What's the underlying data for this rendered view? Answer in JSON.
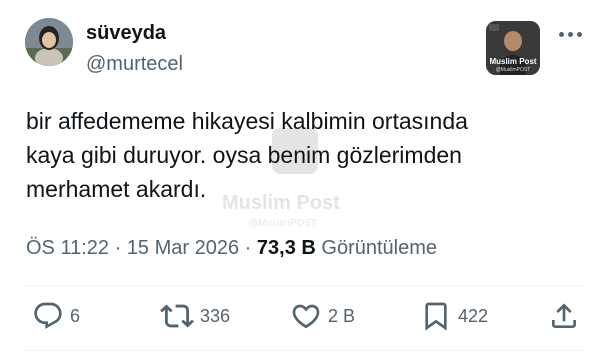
{
  "author": {
    "display_name": "süveyda",
    "handle": "@murtecel"
  },
  "badge": {
    "title": "Muslim Post",
    "subtitle": "@MuslimPOST"
  },
  "tweet": {
    "lines": [
      "bir affedememe hikayesi kalbimin ortasında",
      "kaya gibi duruyor. oysa benim gözlerimden",
      "merhamet akardı."
    ]
  },
  "watermark": {
    "title": "Muslim Post",
    "subtitle": "@MuslimPOST"
  },
  "meta": {
    "time": "ÖS 11:22",
    "separator": " · ",
    "date": "15 Mar 2026",
    "views_count": "73,3 B",
    "views_label": "Görüntüleme"
  },
  "actions": {
    "replies": "6",
    "reposts": "336",
    "likes": "2 B",
    "bookmarks": "422"
  },
  "icons": {
    "reply": "reply-icon",
    "repost": "repost-icon",
    "like": "heart-icon",
    "bookmark": "bookmark-icon",
    "share": "share-icon",
    "more": "more-icon"
  },
  "colors": {
    "text": "#0f1419",
    "secondary": "#536471",
    "divider": "#eff3f4"
  }
}
